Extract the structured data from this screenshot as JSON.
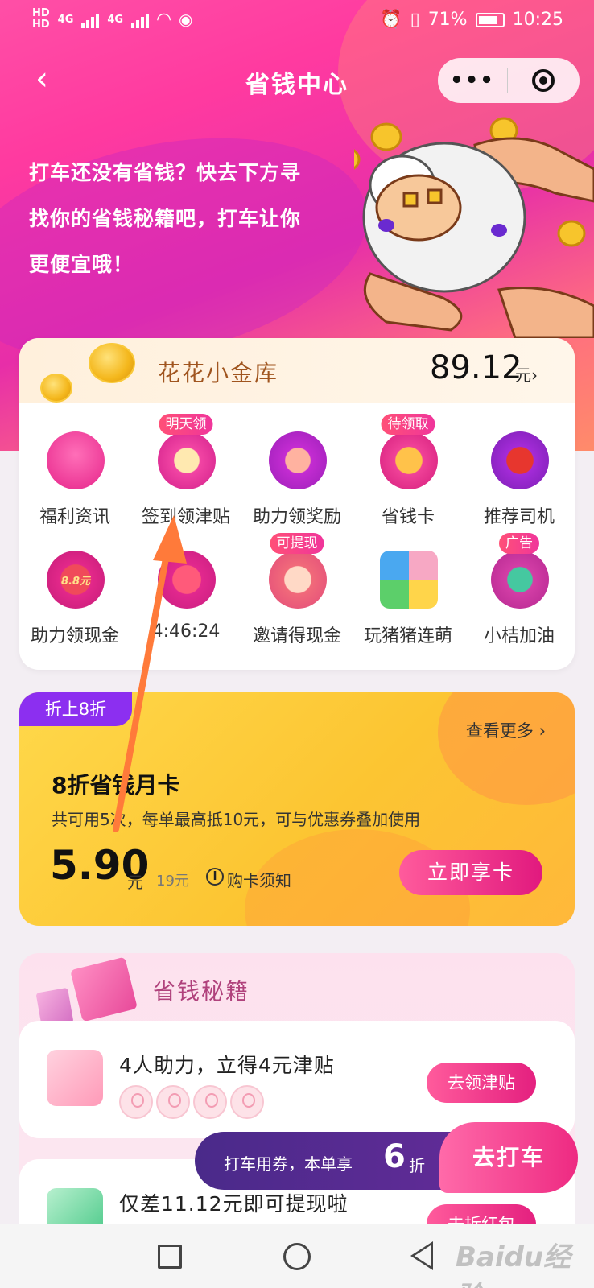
{
  "status_bar": {
    "hd_top": "HD",
    "hd_bottom": "HD",
    "net1": "4G",
    "net2": "4G",
    "battery_percent": "71%",
    "time": "10:25"
  },
  "navbar": {
    "title": "省钱中心",
    "back_icon": "chevron-left-icon",
    "more_icon": "more-dots-icon",
    "close_icon": "target-icon"
  },
  "hero": {
    "intro_lines": [
      "打车还没有省钱？快去下方寻",
      "找你的省钱秘籍吧，打车让你",
      "更便宜哦！"
    ]
  },
  "vault": {
    "title": "花花小金库",
    "amount": "89.12",
    "unit": "元›",
    "items": [
      {
        "label": "福利资讯",
        "badge": ""
      },
      {
        "label": "签到领津贴",
        "badge": "明天领"
      },
      {
        "label": "助力领奖励",
        "badge": ""
      },
      {
        "label": "省钱卡",
        "badge": "待领取"
      },
      {
        "label": "推荐司机",
        "badge": ""
      },
      {
        "label": "助力领现金",
        "badge": "",
        "icon_text": "8.8元"
      },
      {
        "label": "4:46:24",
        "badge": ""
      },
      {
        "label": "邀请得现金",
        "badge": "可提现"
      },
      {
        "label": "玩猪猪连萌",
        "badge": ""
      },
      {
        "label": "小桔加油",
        "badge": "广告"
      }
    ]
  },
  "monthly_card": {
    "tag": "折上8折",
    "more": "查看更多 ›",
    "title": "8折省钱月卡",
    "desc": "共可用5次，每单最高抵10元，可与优惠券叠加使用",
    "price": "5.90",
    "price_unit": "元",
    "original_price": "19元",
    "notice": "购卡须知",
    "buy_button": "立即享卡"
  },
  "tips": {
    "title": "省钱秘籍",
    "tasks": [
      {
        "text": "4人助力，立得4元津贴",
        "button": "去领津贴"
      },
      {
        "text": "仅差11.12元即可提现啦",
        "button": "去拆红包"
      }
    ]
  },
  "float_bar": {
    "text": "打车用券，本单享",
    "discount": "6",
    "zhe": "折",
    "button": "去打车"
  },
  "watermark": "Baidu经验",
  "colors": {
    "accent_pink": "#e4207f",
    "card_yellow": "#fcc532",
    "tag_purple": "#8c2ff0",
    "arrow": "#ff7a3a"
  }
}
